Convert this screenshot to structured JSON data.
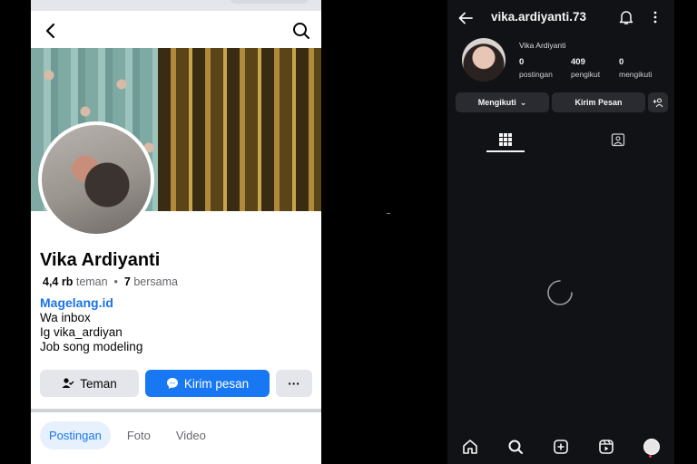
{
  "facebook": {
    "profile_name": "Vika Ardiyanti",
    "friends_count": "4,4 rb",
    "friends_label": "teman",
    "separator": "•",
    "mutual_count": "7",
    "mutual_label": "bersama",
    "location_link": "Magelang.id",
    "bio_lines": [
      "Wa inbox",
      "Ig vika_ardiyan",
      "Job song modeling"
    ],
    "buttons": {
      "friend": "Teman",
      "message": "Kirim pesan",
      "more": "···"
    },
    "tabs": [
      {
        "label": "Postingan",
        "active": true
      },
      {
        "label": "Foto",
        "active": false
      },
      {
        "label": "Video",
        "active": false
      }
    ],
    "colors": {
      "accent": "#1877f2",
      "link": "#1b74e4"
    },
    "icons": [
      "back-arrow-icon",
      "search-icon",
      "person-check-icon",
      "messenger-icon"
    ]
  },
  "instagram": {
    "username": "vika.ardiyanti.73",
    "full_name": "Vika Ardiyanti",
    "stats": [
      {
        "value": "0",
        "label": "postingan"
      },
      {
        "value": "409",
        "label": "pengikut"
      },
      {
        "value": "0",
        "label": "mengikuti"
      }
    ],
    "buttons": {
      "following": "Mengikuti",
      "following_chevron": "⌄",
      "message": "Kirim Pesan"
    },
    "icons": [
      "back-arrow-icon",
      "bell-icon",
      "more-vertical-icon",
      "add-person-icon",
      "grid-icon",
      "tagged-icon",
      "home-icon",
      "search-icon",
      "add-post-icon",
      "reels-icon",
      "profile-icon"
    ],
    "loading": true
  }
}
